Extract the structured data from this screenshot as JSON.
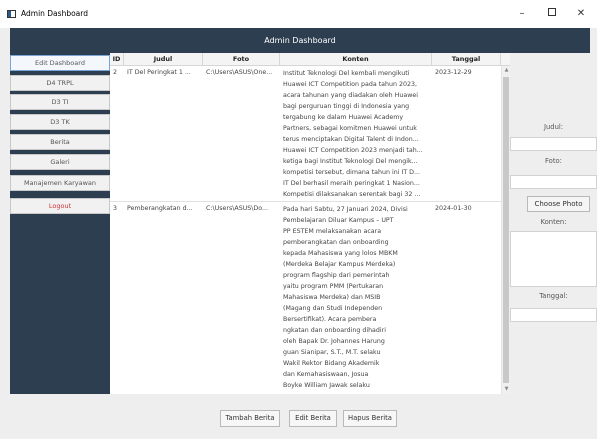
{
  "window": {
    "title": "Admin Dashboard",
    "minimize_symbol": "–",
    "close_symbol": "✕"
  },
  "header": {
    "title": "Admin Dashboard"
  },
  "sidebar": {
    "items": [
      {
        "label": "Edit Dashboard",
        "active": true
      },
      {
        "label": "D4 TRPL"
      },
      {
        "label": "D3 TI"
      },
      {
        "label": "D3 TK"
      },
      {
        "label": "Berita"
      },
      {
        "label": "Galeri"
      },
      {
        "label": "Manajemen Karyawan"
      },
      {
        "label": "Logout",
        "color": "#cc3333"
      }
    ]
  },
  "table": {
    "columns": [
      "ID",
      "Judul",
      "Foto",
      "Konten",
      "Tanggal"
    ],
    "rows": [
      {
        "id": "2",
        "judul": "IT Del Peringkat 1 ...",
        "foto": "C:\\Users\\ASUS\\One...",
        "konten": [
          "Institut Teknologi Del kembali mengikuti",
          "Huawei ICT Competition pada tahun 2023,",
          "acara tahunan yang diadakan oleh Huawei",
          "bagi perguruan tinggi di Indonesia yang",
          "tergabung ke dalam Huawei Academy",
          "Partners, sebagai komitmen Huawei untuk",
          "terus menciptakan Digital Talent di Indon...",
          "Huawei ICT Competition 2023 menjadi tah...",
          "ketiga bagi Institut Teknologi Del mengik...",
          "kompetisi tersebut, dimana tahun ini IT D...",
          "IT Del berhasil meraih peringkat 1 Nasion...",
          "Kompetisi dilaksanakan serentak bagi 32 ..."
        ],
        "tanggal": "2023-12-29"
      },
      {
        "id": "3",
        "judul": "Pemberangkatan d...",
        "foto": "C:\\Users\\ASUS\\Do...",
        "konten": [
          "Pada hari Sabtu, 27 Januari 2024, Divisi",
          "Pembelajaran Diluar Kampus – UPT",
          "PP ESTEM melaksanakan acara",
          "pemberangkatan dan onboarding",
          "kepada Mahasiswa yang lolos MBKM",
          "(Merdeka Belajar Kampus Merdeka)",
          "program flagship dari pemerintah",
          "yaitu program PMM (Pertukaran",
          "Mahasiswa Merdeka) dan MSIB",
          "(Magang dan Studi Independen",
          "Bersertifikat). Acara pembera",
          "ngkatan dan onboarding dihadiri",
          "oleh Bapak Dr. Johannes Harung",
          "guan Sianipar, S.T., M.T. selaku",
          "Wakil Rektor Bidang Akademik",
          "dan Kemahasiswaan,  Josua",
          "Boyke William Jawak selaku"
        ],
        "tanggal": "2024-01-30"
      }
    ]
  },
  "form": {
    "judul_label": "Judul:",
    "foto_label": "Foto:",
    "choose_photo_label": "Choose Photo",
    "konten_label": "Konten:",
    "tanggal_label": "Tanggal:"
  },
  "actions": {
    "tambah_label": "Tambah Berita",
    "edit_label": "Edit Berita",
    "hapus_label": "Hapus Berita"
  }
}
